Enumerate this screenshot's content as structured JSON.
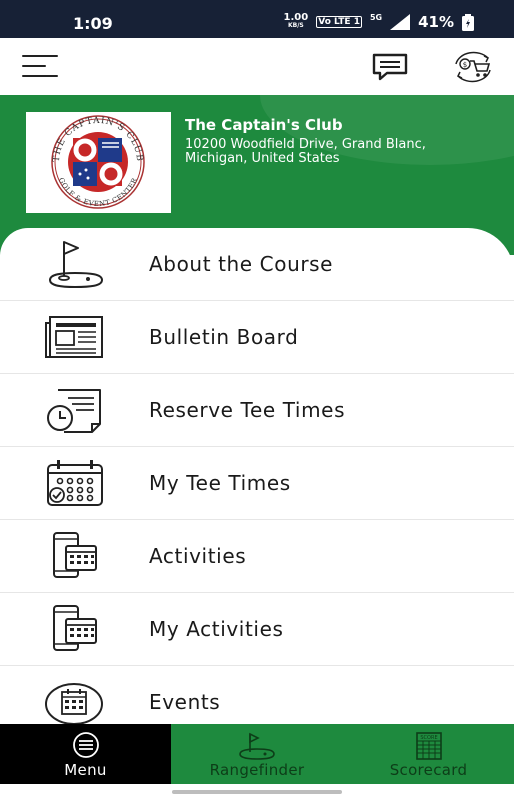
{
  "status_bar": {
    "time": "1:09",
    "net_speed_value": "1.00",
    "net_speed_unit": "KB/S",
    "volte": "Vo LTE 1",
    "network": "5G",
    "battery": "41%"
  },
  "top_bar": {
    "icons": [
      "hamburger-menu-icon",
      "chat-icon",
      "cart-icon"
    ]
  },
  "club": {
    "name": "The Captain's Club",
    "address": "10200 Woodfield Drive, Grand Blanc, Michigan, United States",
    "logo_text": "THE CAPTAIN'S CLUB",
    "logo_subtext": "GOLF & EVENT CENTER",
    "colors": {
      "header_green": "#1e8a3e",
      "logo_red": "#c62828",
      "logo_blue": "#1f3a8a"
    }
  },
  "menu": {
    "items": [
      {
        "label": "About the Course",
        "icon": "golf-flag-icon"
      },
      {
        "label": "Bulletin Board",
        "icon": "newspaper-icon"
      },
      {
        "label": "Reserve Tee Times",
        "icon": "clock-document-icon"
      },
      {
        "label": "My Tee Times",
        "icon": "calendar-icon"
      },
      {
        "label": "Activities",
        "icon": "phone-calendar-icon"
      },
      {
        "label": "My Activities",
        "icon": "phone-calendar-icon"
      },
      {
        "label": "Events",
        "icon": "event-calendar-icon"
      }
    ]
  },
  "bottom_nav": {
    "menu_label": "Menu",
    "rangefinder_label": "Rangefinder",
    "scorecard_label": "Scorecard",
    "scorecard_icon_text": "SCORE"
  }
}
